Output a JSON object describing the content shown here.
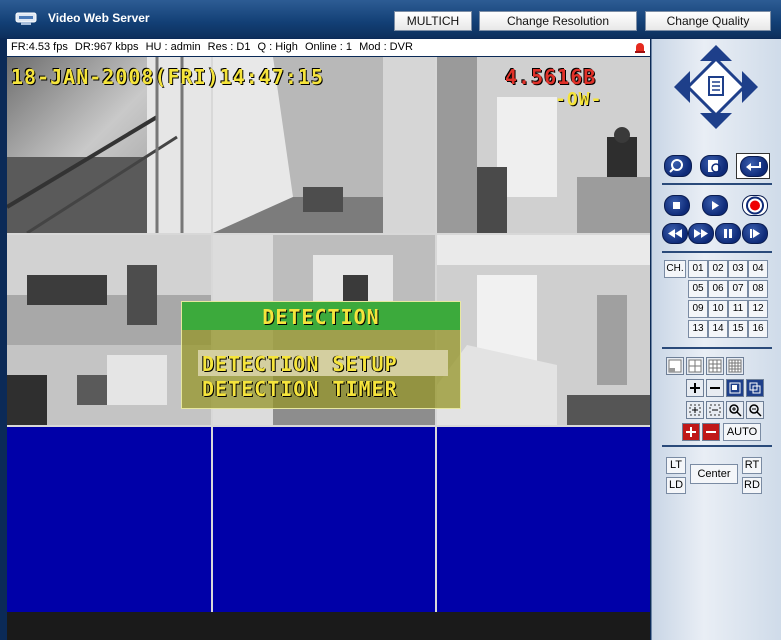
{
  "app": {
    "title": "Video Web Server"
  },
  "toolbar": {
    "multich": "MULTICH",
    "change_resolution": "Change Resolution",
    "change_quality": "Change Quality"
  },
  "status": {
    "fr": "FR:4.53 fps",
    "dr": "DR:967 kbps",
    "hu": "HU : admin",
    "res": "Res : D1",
    "q": "Q : High",
    "online": "Online : 1",
    "mod": "Mod : DVR"
  },
  "osd": {
    "timestamp": "18-JAN-2008(FRI)14:47:15",
    "disk": "4.5616B",
    "mode": "-OW-"
  },
  "menu": {
    "title": "DETECTION",
    "item1": "DETECTION SETUP",
    "item2": "DETECTION TIMER"
  },
  "channels": {
    "label": "CH.",
    "items": [
      "01",
      "02",
      "03",
      "04",
      "05",
      "06",
      "07",
      "08",
      "09",
      "10",
      "11",
      "12",
      "13",
      "14",
      "15",
      "16"
    ]
  },
  "zoom": {
    "auto": "AUTO"
  },
  "ptz": {
    "lt": "LT",
    "ld": "LD",
    "center": "Center",
    "rt": "RT",
    "rd": "RD"
  },
  "colors": {
    "title_bg": "#123f75",
    "video_bg": "#0000a8",
    "osd_yellow": "#f5e43c",
    "osd_red": "#e0322a",
    "menu_green": "#3caa3c"
  }
}
